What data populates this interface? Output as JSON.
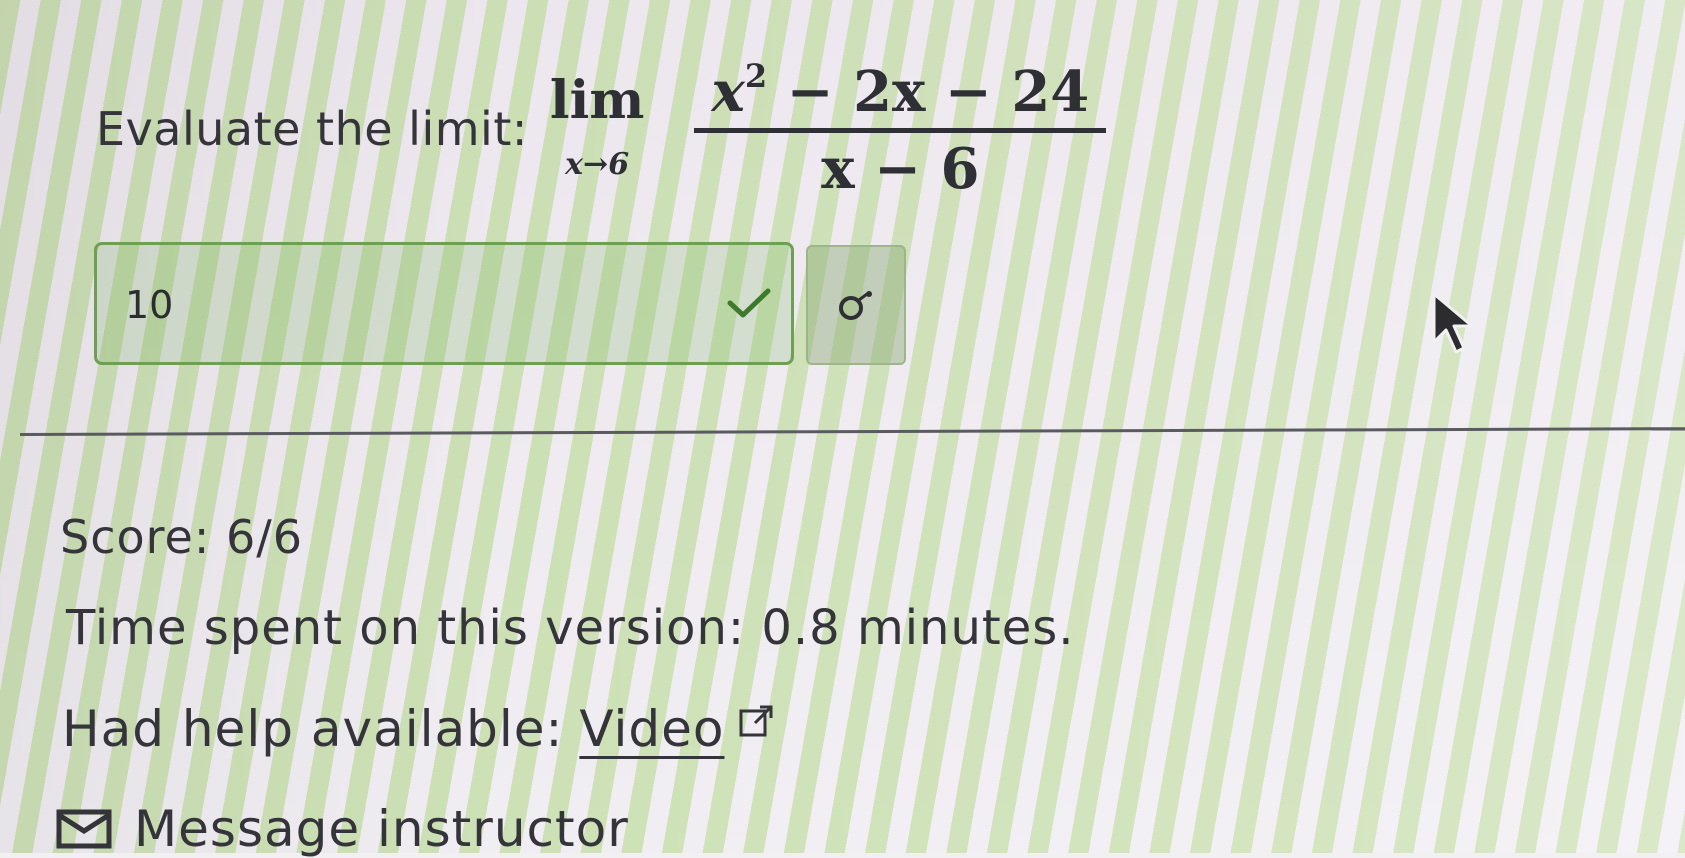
{
  "question": {
    "prompt": "Evaluate the limit:",
    "lim_word": "lim",
    "lim_subscript": "x→6",
    "numerator_before_exp": "x",
    "numerator_exponent": "2",
    "numerator_after_exp": " − 2x − 24",
    "denominator": "x − 6"
  },
  "answer": {
    "value": "10",
    "status_icon": "check-icon",
    "status_color": "#3e7a2c"
  },
  "preview_button": {
    "icon": "preview-icon"
  },
  "results": {
    "score": "Score: 6/6",
    "time_spent": "Time spent on this version: 0.8 minutes.",
    "help_label": "Had help available:",
    "help_link": "Video",
    "help_link_icon": "external-link-icon",
    "message_label": "Message instructor",
    "message_icon": "mail-icon"
  },
  "colors": {
    "correct_border": "#6f9f53",
    "text": "#34343a"
  }
}
